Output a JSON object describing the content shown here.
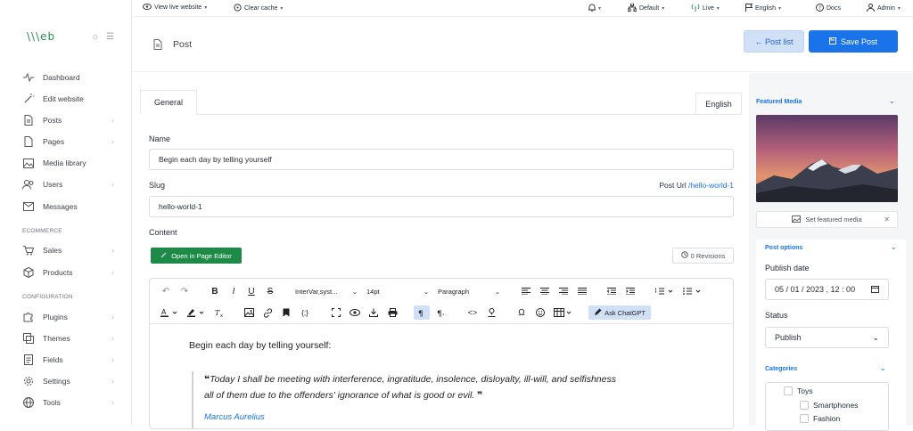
{
  "sidebar": {
    "logo": "\\\\\\eb",
    "items": [
      {
        "label": "Dashboard",
        "icon": "activity-icon",
        "chevron": false
      },
      {
        "label": "Edit website",
        "icon": "magic-wand-icon",
        "chevron": false
      },
      {
        "label": "Posts",
        "icon": "document-icon",
        "chevron": true
      },
      {
        "label": "Pages",
        "icon": "page-icon",
        "chevron": true
      },
      {
        "label": "Media library",
        "icon": "image-icon",
        "chevron": false
      },
      {
        "label": "Users",
        "icon": "users-icon",
        "chevron": true
      },
      {
        "label": "Messages",
        "icon": "mail-icon",
        "chevron": false
      },
      {
        "label": "Sales",
        "icon": "cart-icon",
        "chevron": true
      },
      {
        "label": "Products",
        "icon": "box-icon",
        "chevron": true
      },
      {
        "label": "Plugins",
        "icon": "puzzle-icon",
        "chevron": true
      },
      {
        "label": "Themes",
        "icon": "layers-icon",
        "chevron": true
      },
      {
        "label": "Fields",
        "icon": "form-icon",
        "chevron": true
      },
      {
        "label": "Settings",
        "icon": "gear-icon",
        "chevron": true
      },
      {
        "label": "Tools",
        "icon": "globe-icon",
        "chevron": true
      }
    ],
    "sections": {
      "ecommerce": "ECOMMERCE",
      "configuration": "CONFIGURATION"
    }
  },
  "topbar": {
    "view_site": "View live website",
    "clear_cache": "Clear cache",
    "site": "Default",
    "mode": "Live",
    "language": "English",
    "docs": "Docs",
    "user": "Admin"
  },
  "header": {
    "title": "Post",
    "post_list": "← Post list",
    "save": "Save Post"
  },
  "form": {
    "tab_general": "General",
    "tab_language": "English",
    "name_label": "Name",
    "name_value": "Begin each day by telling yourself",
    "slug_label": "Slug",
    "post_url_label": "Post Url",
    "post_url_value": "/hello-world-1",
    "slug_value": "hello-world-1",
    "content_label": "Content",
    "open_editor": "Open in Page Editor",
    "revisions": "0 Revisions"
  },
  "editor": {
    "font_family": "InterVar,syst...",
    "font_size": "14pt",
    "block_format": "Paragraph",
    "ask_chatgpt": "Ask ChatGPT",
    "content_intro": "Begin each day by telling yourself:",
    "quote_line1": "Today I shall be meeting with interference, ingratitude, insolence, disloyalty, ill-will, and selfishness",
    "quote_line2": "all of them due to the offenders' ignorance of what is good or evil.",
    "quote_author": "Marcus Aurelius"
  },
  "right_panel": {
    "featured_media": "Featured Media",
    "set_media": "Set featured media",
    "post_options": "Post options",
    "publish_date_label": "Publish date",
    "publish_date": "05 / 01 / 2023 ,  12 : 00",
    "status_label": "Status",
    "status_value": "Publish",
    "categories": "Categories",
    "category_items": [
      "Toys",
      "Smartphones",
      "Fashion"
    ]
  },
  "colors": {
    "accent": "#1a73e8",
    "green": "#1e8a48",
    "logo": "#2f8a53"
  }
}
